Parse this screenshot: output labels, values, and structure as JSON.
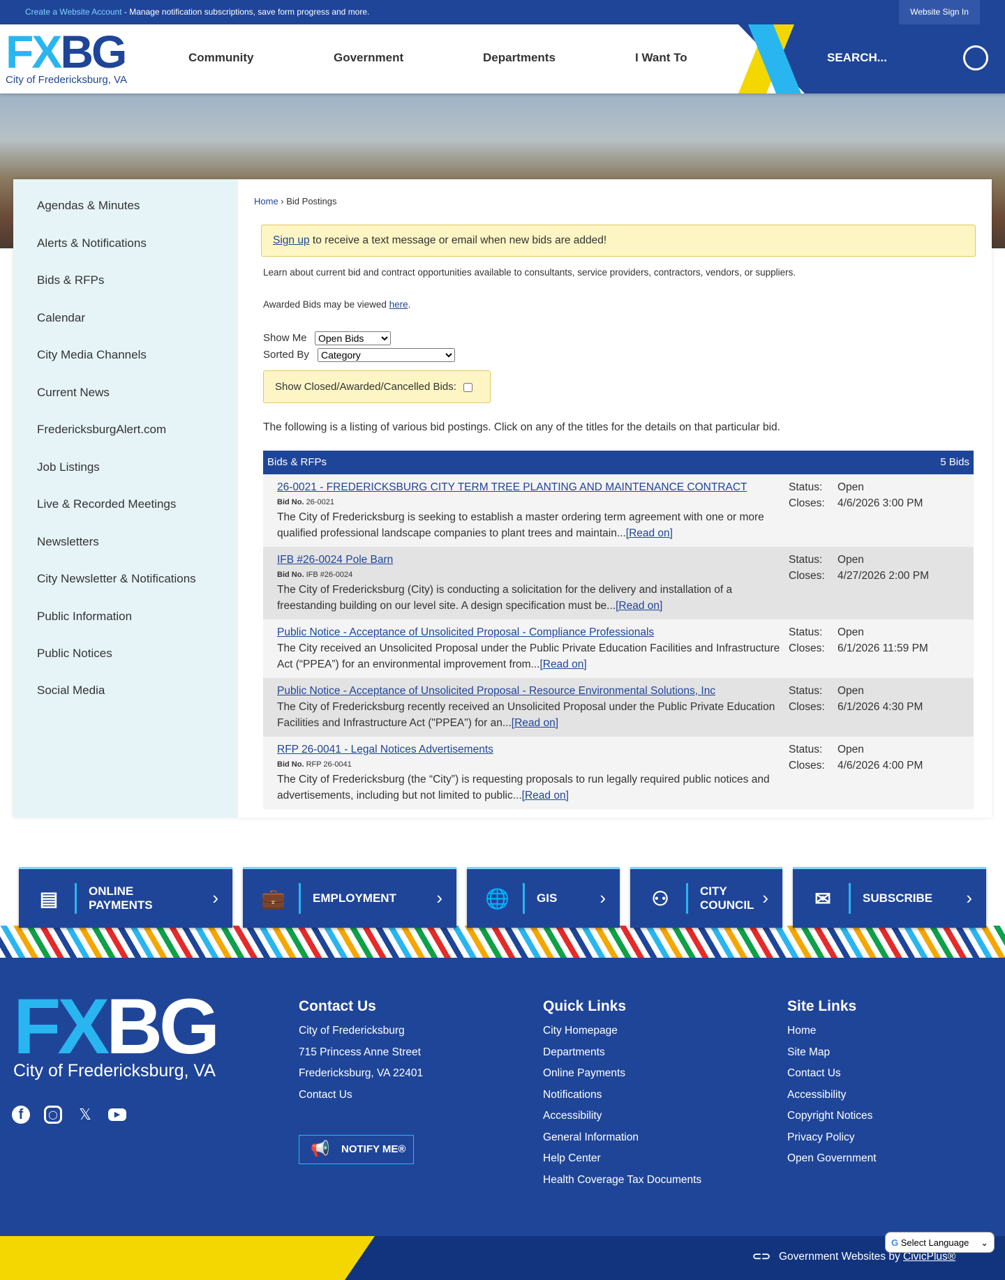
{
  "topbar": {
    "create_link": "Create a Website Account",
    "create_text": " - Manage notification subscriptions, save form progress and more.",
    "signin": "Website Sign In"
  },
  "header": {
    "logo_fx": "FX",
    "logo_bg": "BG",
    "logo_sub": "City of Fredericksburg, VA",
    "nav": [
      "Community",
      "Government",
      "Departments",
      "I Want To"
    ],
    "search": "SEARCH..."
  },
  "sidebar": [
    "Agendas & Minutes",
    "Alerts & Notifications",
    "Bids & RFPs",
    "Calendar",
    "City Media Channels",
    "Current News",
    "FredericksburgAlert.com",
    "Job Listings",
    "Live & Recorded Meetings",
    "Newsletters",
    "City Newsletter & Notifications",
    "Public Information",
    "Public Notices",
    "Social Media"
  ],
  "breadcrumb": {
    "home": "Home",
    "sep": " › ",
    "current": "Bid Postings"
  },
  "signup": {
    "link": "Sign up",
    "text": " to receive a text message or email when new bids are added!"
  },
  "intro": "Learn about current bid and contract opportunities available to consultants, service providers, contractors, vendors, or suppliers.",
  "awarded": {
    "text": "Awarded Bids may be viewed ",
    "link": "here",
    "end": "."
  },
  "filters": {
    "show_label": "Show Me",
    "show_value": "Open Bids",
    "sort_label": "Sorted By",
    "sort_value": "Category",
    "closed_label": "Show Closed/Awarded/Cancelled Bids:"
  },
  "listing_text": "The following is a listing of various bid postings. Click on any of the titles for the details on that particular bid.",
  "table": {
    "title": "Bids & RFPs",
    "count": "5 Bids",
    "status_label": "Status:",
    "closes_label": "Closes:",
    "bidno_label": "Bid No.",
    "read_on": "[Read on]",
    "rows": [
      {
        "title": "26-0021 - FREDERICKSBURG CITY TERM TREE PLANTING AND MAINTENANCE CONTRACT",
        "bid_no": "26-0021",
        "desc": "The City of Fredericksburg is seeking to establish a master ordering term agreement with one or more qualified professional landscape companies to plant trees and maintain...",
        "status": "Open",
        "closes": "4/6/2026 3:00 PM"
      },
      {
        "title": "IFB #26-0024 Pole Barn",
        "bid_no": "IFB #26-0024",
        "desc": "The City of Fredericksburg (City) is conducting a solicitation for the delivery and installation of a freestanding building on our level site. A design specification must be...",
        "status": "Open",
        "closes": "4/27/2026 2:00 PM"
      },
      {
        "title": "Public Notice - Acceptance of Unsolicited Proposal - Compliance Professionals",
        "bid_no": null,
        "desc": "The City received an Unsolicited Proposal under the Public Private Education Facilities and Infrastructure Act (“PPEA”) for an environmental improvement from...",
        "status": "Open",
        "closes": "6/1/2026 11:59 PM"
      },
      {
        "title": "Public Notice - Acceptance of Unsolicited Proposal - Resource Environmental Solutions, Inc",
        "bid_no": null,
        "desc": "The City of Fredericksburg recently received an Unsolicited Proposal under the Public Private Education Facilities and Infrastructure Act (\"PPEA\") for an...",
        "status": "Open",
        "closes": "6/1/2026 4:30 PM"
      },
      {
        "title": "RFP 26-0041 - Legal Notices Advertisements",
        "bid_no": "RFP 26-0041",
        "desc": "The City of Fredericksburg (the “City”) is requesting proposals to run legally required public notices and advertisements, including but not limited to public...",
        "status": "Open",
        "closes": "4/6/2026 4:00 PM"
      }
    ]
  },
  "quick": [
    {
      "l1": "ONLINE",
      "l2": "PAYMENTS",
      "icon": "payment-icon"
    },
    {
      "l1": "EMPLOYMENT",
      "l2": "",
      "icon": "briefcase-icon"
    },
    {
      "l1": "GIS",
      "l2": "",
      "icon": "globe-icon"
    },
    {
      "l1": "CITY",
      "l2": "COUNCIL",
      "icon": "people-icon"
    },
    {
      "l1": "SUBSCRIBE",
      "l2": "",
      "icon": "mail-icon"
    }
  ],
  "footer": {
    "logo_fx": "FX",
    "logo_bg": "BG",
    "logo_sub": "City of Fredericksburg, VA",
    "notify": "NOTIFY ME®",
    "contact": {
      "title": "Contact Us",
      "lines": [
        "City of Fredericksburg",
        "715 Princess Anne Street",
        "Fredericksburg, VA 22401",
        "Contact Us"
      ]
    },
    "quick": {
      "title": "Quick Links",
      "links": [
        "City Homepage",
        "Departments",
        "Online Payments",
        "Notifications",
        "Accessibility",
        "General Information",
        "Help Center",
        "Health Coverage Tax Documents"
      ]
    },
    "site": {
      "title": "Site Links",
      "links": [
        "Home",
        "Site Map",
        "Contact Us",
        "Accessibility",
        "Copyright Notices",
        "Privacy Policy",
        "Open Government"
      ]
    },
    "civic_text": "Government Websites by ",
    "civic_link": "CivicPlus®",
    "language": "Select Language"
  }
}
